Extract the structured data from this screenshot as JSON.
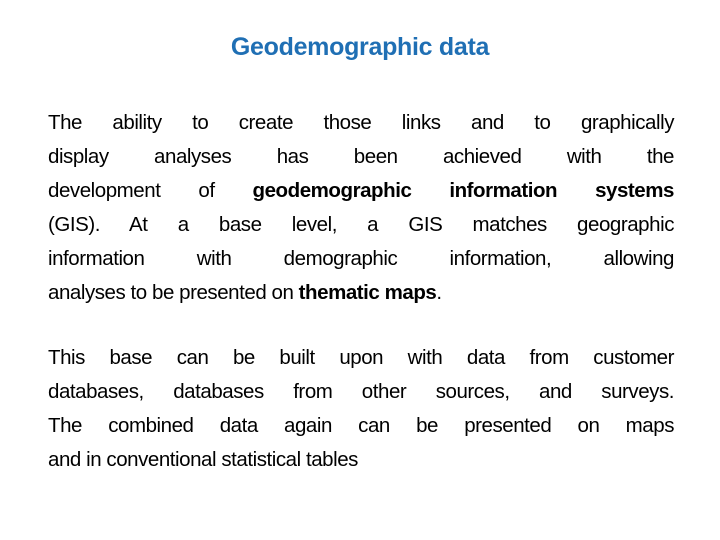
{
  "slide": {
    "title": "Geodemographic data",
    "title_color": "#1f6fb4",
    "paragraphs": [
      {
        "lines": [
          {
            "runs": [
              {
                "text": "The ability to create those links and to graphically",
                "bold": false
              }
            ]
          },
          {
            "runs": [
              {
                "text": "display analyses has been achieved with the",
                "bold": false
              }
            ]
          },
          {
            "runs": [
              {
                "text": "development of ",
                "bold": false
              },
              {
                "text": "geodemographic information systems",
                "bold": true
              }
            ]
          },
          {
            "runs": [
              {
                "text": "(GIS). At a base level, a GIS matches geographic",
                "bold": false
              }
            ]
          },
          {
            "runs": [
              {
                "text": "information with demographic information, allowing",
                "bold": false
              }
            ]
          },
          {
            "runs": [
              {
                "text": "analyses to be presented on ",
                "bold": false
              },
              {
                "text": "thematic maps",
                "bold": true
              },
              {
                "text": ".",
                "bold": false
              }
            ]
          }
        ]
      },
      {
        "lines": [
          {
            "runs": [
              {
                "text": "This base can be built upon with data from customer",
                "bold": false
              }
            ]
          },
          {
            "runs": [
              {
                "text": "databases, databases from other sources, and surveys.",
                "bold": false
              }
            ]
          },
          {
            "runs": [
              {
                "text": "The combined data again can be presented on maps",
                "bold": false
              }
            ]
          },
          {
            "runs": [
              {
                "text": "and in conventional statistical tables",
                "bold": false
              }
            ]
          }
        ]
      }
    ]
  }
}
